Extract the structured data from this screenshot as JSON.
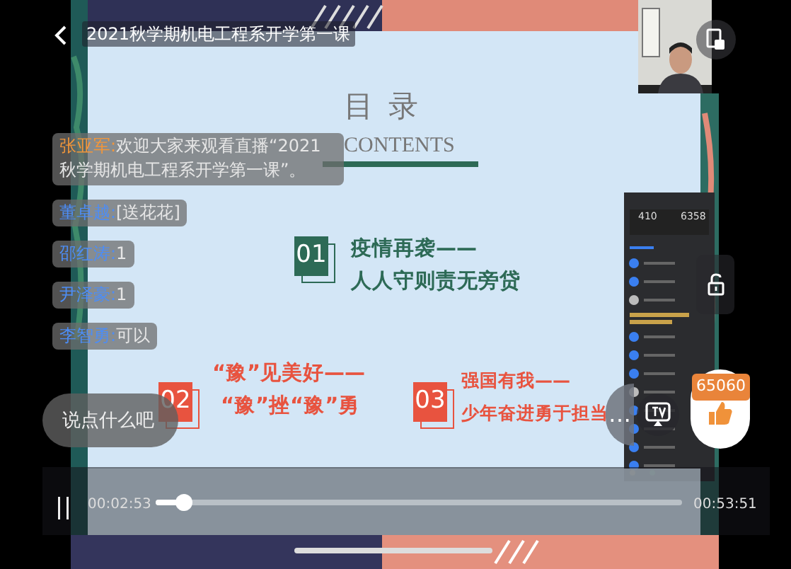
{
  "header": {
    "title": "2021秋学期机电工程系开学第一课"
  },
  "slide": {
    "title": "目 录",
    "subtitle": "CONTENTS",
    "items": [
      {
        "number": "01",
        "lines": [
          "疫情再袭——",
          "人人守则责无旁贷"
        ],
        "color": "#2d6a56"
      },
      {
        "number": "02",
        "lines": [
          "“豫”见美好——",
          "“豫”挫“豫”勇"
        ],
        "color": "#e8533f"
      },
      {
        "number": "03",
        "lines": [
          "强国有我——",
          "少年奋进勇于担当"
        ],
        "color": "#e8533f"
      }
    ]
  },
  "embedded_panel": {
    "stats": [
      "410",
      "6358"
    ]
  },
  "chat": {
    "messages": [
      {
        "kind": "host",
        "user": "张亚军:",
        "text": "欢迎大家来观看直播“2021秋学期机电工程系开学第一课”。"
      },
      {
        "kind": "viewer",
        "user": "董卓越:",
        "text": "[送花花]"
      },
      {
        "kind": "viewer",
        "user": "邵红涛:",
        "text": "1"
      },
      {
        "kind": "viewer",
        "user": "尹泽豪:",
        "text": "1"
      },
      {
        "kind": "viewer",
        "user": "李智勇:",
        "text": "可以"
      }
    ],
    "input": {
      "placeholder": "说点什么吧"
    }
  },
  "more_button": {
    "label": "…"
  },
  "likes": {
    "count": "65060"
  },
  "player": {
    "paused": false,
    "elapsed": "00:02:53",
    "level": 0.054,
    "duration": "00:53:51"
  }
}
